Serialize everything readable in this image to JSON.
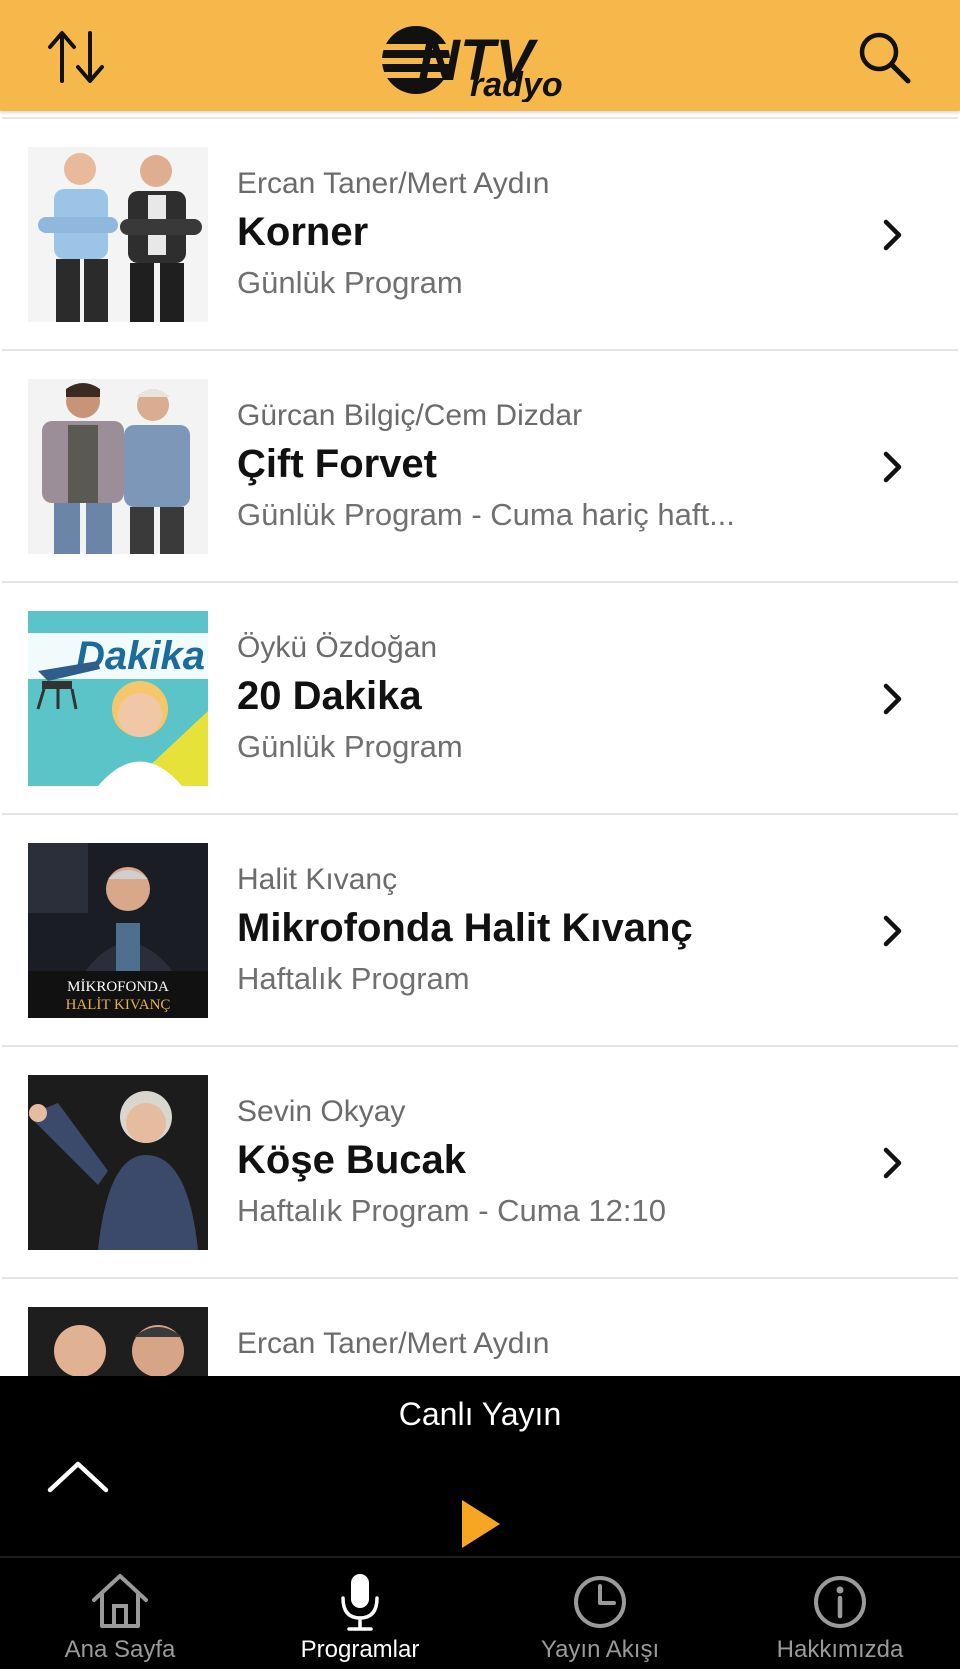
{
  "header": {
    "sort_icon": "sort-arrows-icon",
    "search_icon": "search-icon",
    "logo_text_main": "NTV",
    "logo_text_sub": "radyo",
    "brand_color": "#f6b84a"
  },
  "programs": [
    {
      "host": "Ercan Taner/Mert Aydın",
      "title": "Korner",
      "schedule": "Günlük Program"
    },
    {
      "host": "Gürcan Bilgiç/Cem Dizdar",
      "title": "Çift Forvet",
      "schedule": "Günlük Program - Cuma hariç haft..."
    },
    {
      "host": "Öykü Özdoğan",
      "title": "20 Dakika",
      "schedule": "Günlük Program",
      "thumb_text": "Dakika"
    },
    {
      "host": "Halit Kıvanç",
      "title": "Mikrofonda Halit Kıvanç",
      "schedule": "Haftalık Program",
      "thumb_line1": "MİKROFONDA",
      "thumb_line2": "HALİT KIVANÇ"
    },
    {
      "host": "Sevin Okyay",
      "title": "Köşe Bucak",
      "schedule": "Haftalık Program - Cuma 12:10"
    },
    {
      "host": "Ercan Taner/Mert Aydın",
      "title": "",
      "schedule": ""
    }
  ],
  "player": {
    "label": "Canlı Yayın",
    "play_color": "#f6a623"
  },
  "tabs": [
    {
      "label": "Ana Sayfa",
      "icon": "home-icon"
    },
    {
      "label": "Programlar",
      "icon": "microphone-icon",
      "active": true
    },
    {
      "label": "Yayın Akışı",
      "icon": "clock-icon"
    },
    {
      "label": "Hakkımızda",
      "icon": "info-icon"
    }
  ]
}
